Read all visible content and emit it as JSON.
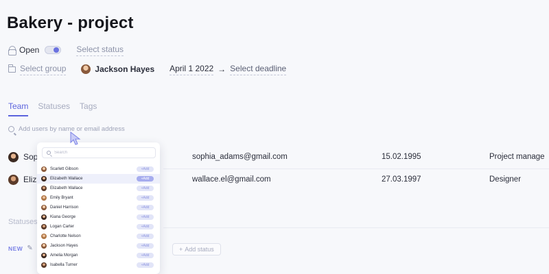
{
  "header": {
    "title": "Bakery - project"
  },
  "meta": {
    "open_label": "Open",
    "status_placeholder": "Select status",
    "group_placeholder": "Select group",
    "owner": "Jackson Hayes",
    "start_date": "April 1 2022",
    "arrow": "→",
    "deadline_placeholder": "Select deadline"
  },
  "tabs": [
    {
      "label": "Team",
      "active": true
    },
    {
      "label": "Statuses",
      "active": false
    },
    {
      "label": "Tags",
      "active": false
    }
  ],
  "search": {
    "placeholder": "Add users by name or email address"
  },
  "members": [
    {
      "name": "Sophia Adams",
      "visible_name": "Sop",
      "email": "sophia_adams@gmail.com",
      "date": "15.02.1995",
      "role": "Project manage"
    },
    {
      "name": "Elizabeth Wallace",
      "visible_name": "Eliz",
      "email": "wallace.el@gmail.com",
      "date": "27.03.1997",
      "role": "Designer"
    }
  ],
  "statuses_section": {
    "label": "Statuses",
    "new_tag": "NEW",
    "add_status": "Add status"
  },
  "dropdown": {
    "search_placeholder": "Search",
    "add_label": "Add",
    "items": [
      {
        "name": "Scarlett Gibson",
        "highlight": false
      },
      {
        "name": "Elizabeth Wallace",
        "highlight": true
      },
      {
        "name": "Elizabeth Wallace",
        "highlight": false
      },
      {
        "name": "Emily Bryant",
        "highlight": false
      },
      {
        "name": "Daniel Harrison",
        "highlight": false
      },
      {
        "name": "Kiana George",
        "highlight": false
      },
      {
        "name": "Logan Carter",
        "highlight": false
      },
      {
        "name": "Charlotte Nelson",
        "highlight": false
      },
      {
        "name": "Jackson Hayes",
        "highlight": false
      },
      {
        "name": "Amelia Morgan",
        "highlight": false
      },
      {
        "name": "Isabella Turner",
        "highlight": false
      }
    ]
  },
  "colors": {
    "accent": "#5b63dd",
    "text": "#2a2d3a",
    "muted": "#a6abbf"
  }
}
